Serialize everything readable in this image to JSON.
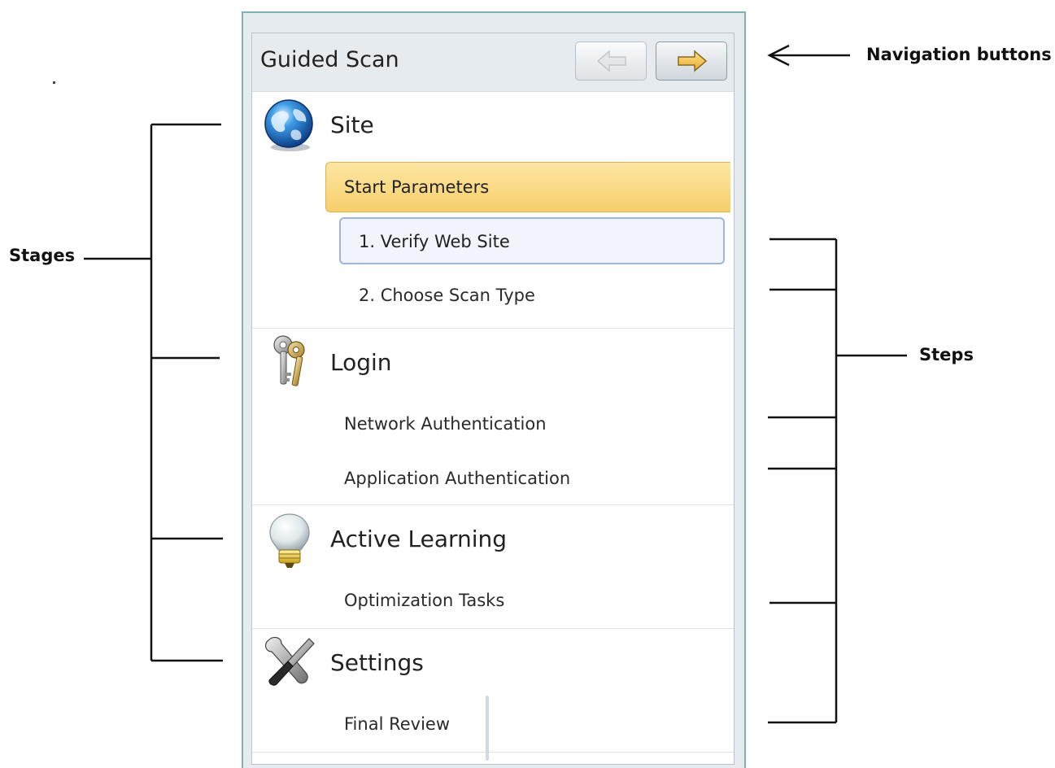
{
  "panel": {
    "title": "Guided Scan",
    "nav": {
      "back_icon": "arrow-left-icon",
      "forward_icon": "arrow-right-icon"
    },
    "stages": [
      {
        "label": "Site",
        "icon": "globe-icon",
        "steps": [
          "Start Parameters",
          "1. Verify Web Site",
          "2. Choose Scan Type"
        ]
      },
      {
        "label": "Login",
        "icon": "keys-icon",
        "steps": [
          "Network Authentication",
          "Application Authentication"
        ]
      },
      {
        "label": "Active Learning",
        "icon": "lightbulb-icon",
        "steps": [
          "Optimization Tasks"
        ]
      },
      {
        "label": "Settings",
        "icon": "tools-icon",
        "steps": [
          "Final Review"
        ]
      }
    ]
  },
  "annotations": {
    "navigation": "Navigation buttons",
    "stages": "Stages",
    "steps": "Steps"
  },
  "colors": {
    "active_step": "#f8cf6b",
    "selected_step_border": "#9fb4de",
    "frame": "#7fb3ad"
  }
}
